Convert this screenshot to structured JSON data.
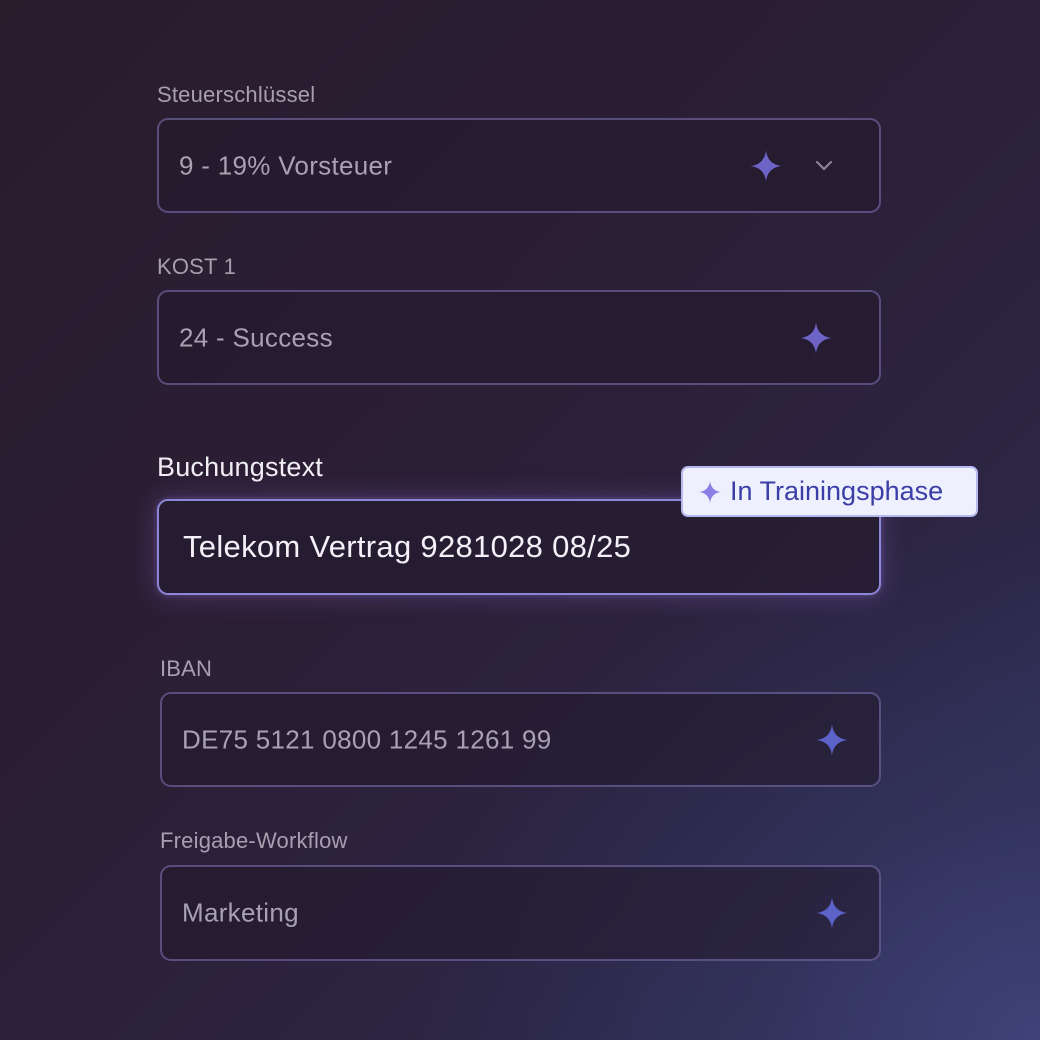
{
  "fields": [
    {
      "label": "Steuerschlüssel",
      "value": "9 - 19% Vorsteuer",
      "icons": [
        "sparkle-icon",
        "chevron-down-icon"
      ]
    },
    {
      "label": "KOST 1",
      "value": "24 - Success",
      "icons": [
        "sparkle-icon"
      ]
    },
    {
      "label": "Buchungstext",
      "value": "Telekom Vertrag 9281028 08/25",
      "active": true
    },
    {
      "label": "IBAN",
      "value": "DE75 5121 0800 1245 1261 99",
      "icons": [
        "sparkle-icon"
      ]
    },
    {
      "label": "Freigabe-Workflow",
      "value": "Marketing",
      "icons": [
        "sparkle-icon"
      ]
    }
  ],
  "badge": {
    "text": "In Trainingsphase",
    "icon": "sparkle-icon"
  },
  "colors": {
    "sparkle": "#6e64c8",
    "sparkle_bright": "#5c62c8",
    "active_border": "#8b86d6",
    "badge_text": "#3a3ea6",
    "badge_bg": "#eef0fd"
  }
}
